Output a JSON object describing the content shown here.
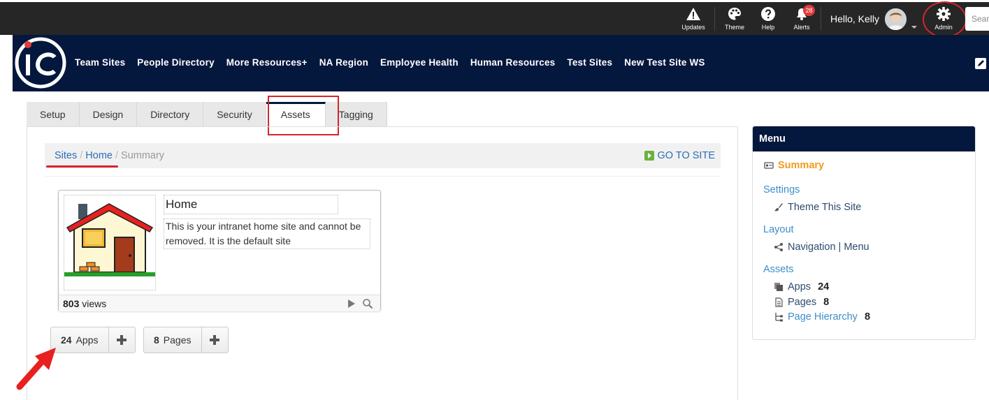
{
  "topbar": {
    "items": [
      {
        "label": "Updates",
        "icon": "warning-icon"
      },
      {
        "label": "Theme",
        "icon": "palette-icon"
      },
      {
        "label": "Help",
        "icon": "help-icon"
      },
      {
        "label": "Alerts",
        "icon": "bell-icon",
        "badge": "28"
      }
    ],
    "greeting": "Hello, Kelly",
    "admin_label": "Admin",
    "search_placeholder": "Search"
  },
  "nav": {
    "links": [
      "Team Sites",
      "People Directory",
      "More Resources+",
      "NA Region",
      "Employee Health",
      "Human Resources",
      "Test Sites",
      "New Test Site WS"
    ]
  },
  "tabs": [
    "Setup",
    "Design",
    "Directory",
    "Security",
    "Assets",
    "Tagging"
  ],
  "active_tab": "Assets",
  "breadcrumb": {
    "sites": "Sites",
    "home": "Home",
    "current": "Summary",
    "go_to_site": "GO TO SITE"
  },
  "site_card": {
    "title": "Home",
    "description": "This is your intranet home site and cannot be removed. It is the default site",
    "views_count": "803",
    "views_label": "views"
  },
  "counts": {
    "apps": {
      "count": "24",
      "label": "Apps"
    },
    "pages": {
      "count": "8",
      "label": "Pages"
    }
  },
  "menu": {
    "title": "Menu",
    "summary": "Summary",
    "settings": "Settings",
    "theme_site": "Theme This Site",
    "layout": "Layout",
    "navigation": "Navigation | Menu",
    "assets": "Assets",
    "apps_label": "Apps",
    "apps_count": "24",
    "pages_label": "Pages",
    "pages_count": "8",
    "hierarchy_label": "Page Hierarchy",
    "hierarchy_count": "8"
  },
  "colors": {
    "navy": "#04173d",
    "accent_red": "#d4252b",
    "link_blue": "#2a6db5",
    "summary_orange": "#f29b1d"
  }
}
